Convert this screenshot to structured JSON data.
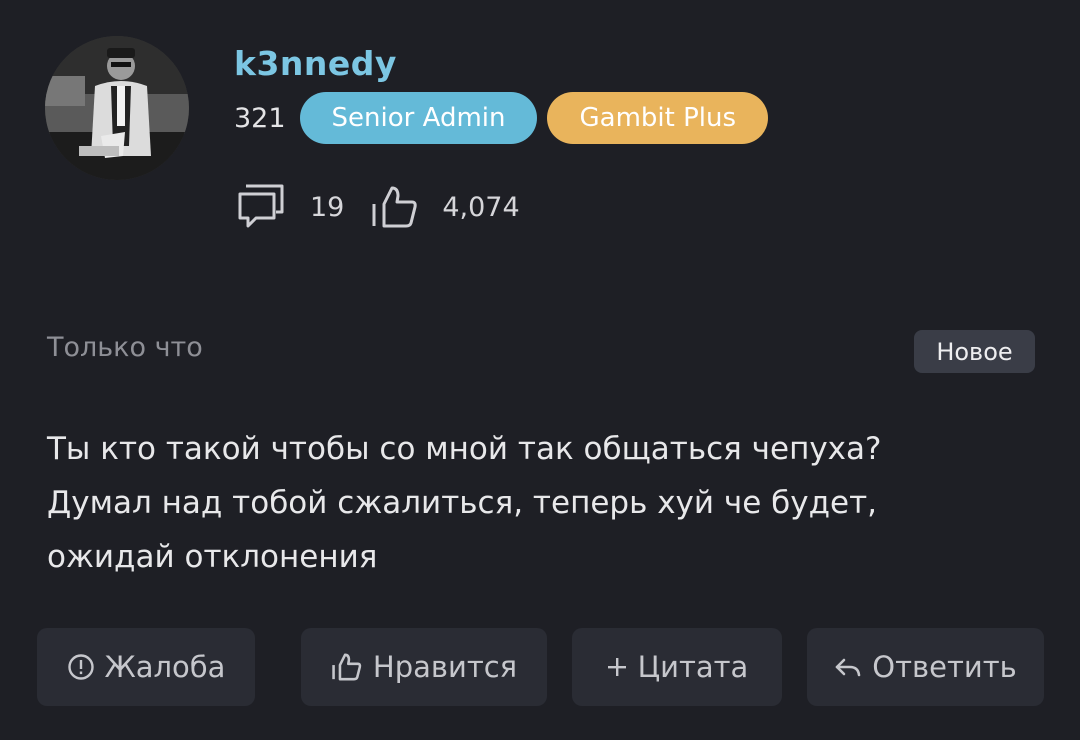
{
  "user": {
    "name": "k3nnedy",
    "post_count": "321",
    "badges": [
      "Senior Admin",
      "Gambit Plus"
    ],
    "colors": {
      "username": "#7cc6e3",
      "senior_admin": "#64bad8",
      "gambit_plus": "#e9b45c"
    }
  },
  "stats": {
    "messages_icon": "comment-icon",
    "messages": "19",
    "likes_icon": "thumbs-up-icon",
    "likes": "4,074"
  },
  "post": {
    "time": "Только что",
    "new_label": "Новое",
    "lines": [
      "Ты кто такой чтобы со мной так общаться чепуха?",
      "Думал над тобой сжалиться, теперь хуй че будет,",
      "ожидай отклонения"
    ]
  },
  "actions": {
    "report": "Жалоба",
    "like": "Нравится",
    "quote": "Цитата",
    "reply": "Ответить"
  }
}
